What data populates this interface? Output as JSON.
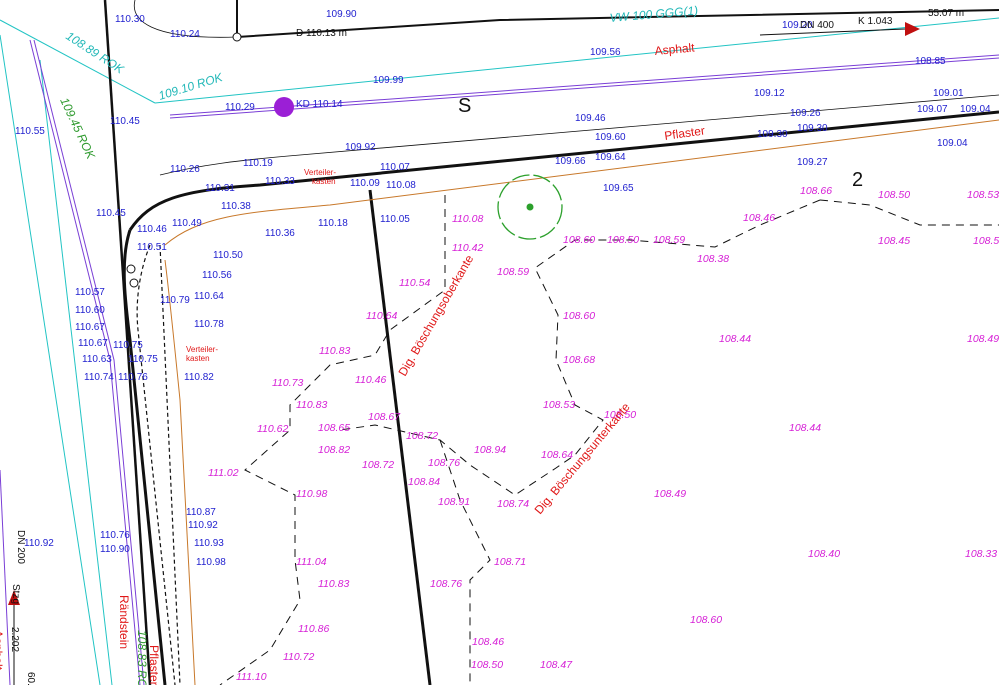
{
  "map": {
    "labels": [
      {
        "text": "110.30",
        "cls": "blue"
      },
      {
        "text": "110.24",
        "cls": "blue"
      },
      {
        "text": "D 110.13 m",
        "cls": "blk"
      },
      {
        "text": "109.90",
        "cls": "blue"
      },
      {
        "text": "109.20",
        "cls": "blue"
      },
      {
        "text": "DN 400",
        "cls": "blk"
      },
      {
        "text": "K 1.043",
        "cls": "blk"
      },
      {
        "text": "55.07 m",
        "cls": "blk"
      },
      {
        "text": "VW 100 GGG(1)",
        "cls": "cyan"
      },
      {
        "text": "108.89 ROK",
        "cls": "cyan"
      },
      {
        "text": "109.10 ROK",
        "cls": "cyan"
      },
      {
        "text": "109.56",
        "cls": "blue"
      },
      {
        "text": "Asphalt",
        "cls": "red"
      },
      {
        "text": "108.85",
        "cls": "blue"
      },
      {
        "text": "109.99",
        "cls": "blue"
      },
      {
        "text": "110.29",
        "cls": "blue"
      },
      {
        "text": "KD 110.14",
        "cls": "blue"
      },
      {
        "text": "S",
        "cls": "big"
      },
      {
        "text": "109.12",
        "cls": "blue"
      },
      {
        "text": "109.01",
        "cls": "blue"
      },
      {
        "text": "109.07",
        "cls": "blue"
      },
      {
        "text": "109.04",
        "cls": "blue"
      },
      {
        "text": "109.26",
        "cls": "blue"
      },
      {
        "text": "110.55",
        "cls": "blue"
      },
      {
        "text": "110.45",
        "cls": "blue"
      },
      {
        "text": "109.45 ROK",
        "cls": "green"
      },
      {
        "text": "109.46",
        "cls": "blue"
      },
      {
        "text": "109.60",
        "cls": "blue"
      },
      {
        "text": "Pflaster",
        "cls": "red"
      },
      {
        "text": "109.30",
        "cls": "blue"
      },
      {
        "text": "109.30",
        "cls": "blue"
      },
      {
        "text": "109.04",
        "cls": "blue"
      },
      {
        "text": "109.92",
        "cls": "blue"
      },
      {
        "text": "110.07",
        "cls": "blue"
      },
      {
        "text": "109.66",
        "cls": "blue"
      },
      {
        "text": "109.64",
        "cls": "blue"
      },
      {
        "text": "109.27",
        "cls": "blue"
      },
      {
        "text": "110.26",
        "cls": "blue"
      },
      {
        "text": "110.19",
        "cls": "blue"
      },
      {
        "text": "110.33",
        "cls": "blue"
      },
      {
        "text": "110.31",
        "cls": "blue"
      },
      {
        "text": "Verteiler-",
        "cls": "redsm"
      },
      {
        "text": "kasten",
        "cls": "redsm"
      },
      {
        "text": "110.09",
        "cls": "blue"
      },
      {
        "text": "110.08",
        "cls": "blue"
      },
      {
        "text": "109.65",
        "cls": "blue"
      },
      {
        "text": "108.66",
        "cls": "mag"
      },
      {
        "text": "2",
        "cls": "big"
      },
      {
        "text": "108.50",
        "cls": "mag"
      },
      {
        "text": "108.53",
        "cls": "mag"
      },
      {
        "text": "110.38",
        "cls": "blue"
      },
      {
        "text": "110.45",
        "cls": "blue"
      },
      {
        "text": "110.46",
        "cls": "blue"
      },
      {
        "text": "110.49",
        "cls": "blue"
      },
      {
        "text": "110.36",
        "cls": "blue"
      },
      {
        "text": "110.18",
        "cls": "blue"
      },
      {
        "text": "110.05",
        "cls": "blue"
      },
      {
        "text": "110.08",
        "cls": "mag"
      },
      {
        "text": "108.46",
        "cls": "mag"
      },
      {
        "text": "108.45",
        "cls": "mag"
      },
      {
        "text": "108.5",
        "cls": "mag"
      },
      {
        "text": "110.51",
        "cls": "blue"
      },
      {
        "text": "110.42",
        "cls": "mag"
      },
      {
        "text": "108.60",
        "cls": "mag"
      },
      {
        "text": "108.50",
        "cls": "mag"
      },
      {
        "text": "108.59",
        "cls": "mag"
      },
      {
        "text": "108.38",
        "cls": "mag"
      },
      {
        "text": "110.50",
        "cls": "blue"
      },
      {
        "text": "110.56",
        "cls": "blue"
      },
      {
        "text": "108.59",
        "cls": "mag"
      },
      {
        "text": "110.54",
        "cls": "mag"
      },
      {
        "text": "110.57",
        "cls": "blue"
      },
      {
        "text": "110.64",
        "cls": "blue"
      },
      {
        "text": "110.79",
        "cls": "blue"
      },
      {
        "text": "110.60",
        "cls": "blue"
      },
      {
        "text": "110.64",
        "cls": "mag"
      },
      {
        "text": "Dig. Böschungsoberkante",
        "cls": "red"
      },
      {
        "text": "108.60",
        "cls": "mag"
      },
      {
        "text": "110.67",
        "cls": "blue"
      },
      {
        "text": "110.78",
        "cls": "blue"
      },
      {
        "text": "108.44",
        "cls": "mag"
      },
      {
        "text": "108.49",
        "cls": "mag"
      },
      {
        "text": "110.67",
        "cls": "blue"
      },
      {
        "text": "110.75",
        "cls": "blue"
      },
      {
        "text": "Verteiler-",
        "cls": "redsm"
      },
      {
        "text": "kasten",
        "cls": "redsm"
      },
      {
        "text": "110.83",
        "cls": "mag"
      },
      {
        "text": "108.68",
        "cls": "mag"
      },
      {
        "text": "110.63",
        "cls": "blue"
      },
      {
        "text": "110.75",
        "cls": "blue"
      },
      {
        "text": "110.74",
        "cls": "blue"
      },
      {
        "text": "110.76",
        "cls": "blue"
      },
      {
        "text": "110.82",
        "cls": "blue"
      },
      {
        "text": "110.46",
        "cls": "mag"
      },
      {
        "text": "110.73",
        "cls": "mag"
      },
      {
        "text": "108.53",
        "cls": "mag"
      },
      {
        "text": "108.50",
        "cls": "mag"
      },
      {
        "text": "110.83",
        "cls": "mag"
      },
      {
        "text": "108.67",
        "cls": "mag"
      },
      {
        "text": "108.44",
        "cls": "mag"
      },
      {
        "text": "110.62",
        "cls": "mag"
      },
      {
        "text": "108.65",
        "cls": "mag"
      },
      {
        "text": "108.72",
        "cls": "mag"
      },
      {
        "text": "108.94",
        "cls": "mag"
      },
      {
        "text": "Dig. Böschungsunterkante",
        "cls": "red"
      },
      {
        "text": "108.82",
        "cls": "mag"
      },
      {
        "text": "108.72",
        "cls": "mag"
      },
      {
        "text": "108.76",
        "cls": "mag"
      },
      {
        "text": "108.64",
        "cls": "mag"
      },
      {
        "text": "111.02",
        "cls": "mag"
      },
      {
        "text": "108.84",
        "cls": "mag"
      },
      {
        "text": "110.98",
        "cls": "mag"
      },
      {
        "text": "108.91",
        "cls": "mag"
      },
      {
        "text": "108.74",
        "cls": "mag"
      },
      {
        "text": "108.49",
        "cls": "mag"
      },
      {
        "text": "110.87",
        "cls": "blue"
      },
      {
        "text": "110.92",
        "cls": "blue"
      },
      {
        "text": "110.76",
        "cls": "blue"
      },
      {
        "text": "110.93",
        "cls": "blue"
      },
      {
        "text": "110.90",
        "cls": "blue"
      },
      {
        "text": "110.98",
        "cls": "blue"
      },
      {
        "text": "110.92",
        "cls": "blue"
      },
      {
        "text": "DN 200",
        "cls": "blk"
      },
      {
        "text": "111.04",
        "cls": "mag"
      },
      {
        "text": "108.71",
        "cls": "mag"
      },
      {
        "text": "108.40",
        "cls": "mag"
      },
      {
        "text": "108.33",
        "cls": "mag"
      },
      {
        "text": "110.83",
        "cls": "mag"
      },
      {
        "text": "108.76",
        "cls": "mag"
      },
      {
        "text": "Rändstein",
        "cls": "red"
      },
      {
        "text": "Stzg",
        "cls": "blk"
      },
      {
        "text": "2.202",
        "cls": "blk"
      },
      {
        "text": "108.60",
        "cls": "mag"
      },
      {
        "text": "110.86",
        "cls": "mag"
      },
      {
        "text": "108.46",
        "cls": "mag"
      },
      {
        "text": "110.72",
        "cls": "mag"
      },
      {
        "text": "108.50",
        "cls": "mag"
      },
      {
        "text": "108.47",
        "cls": "mag"
      },
      {
        "text": "Asphalt",
        "cls": "red"
      },
      {
        "text": "Pflaster",
        "cls": "red"
      },
      {
        "text": "111.10",
        "cls": "mag"
      },
      {
        "text": "108.83 ROK",
        "cls": "green"
      },
      {
        "text": "60.0",
        "cls": "blk"
      }
    ]
  }
}
